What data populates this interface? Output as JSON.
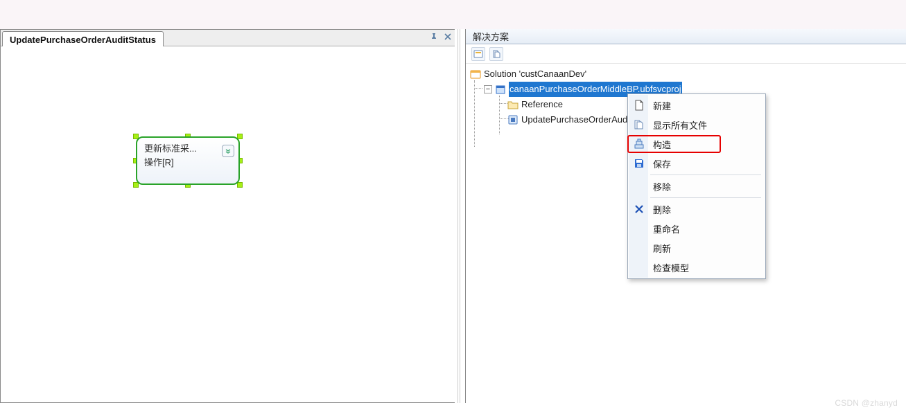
{
  "left": {
    "tab_title": "UpdatePurchaseOrderAuditStatus",
    "node_line1": "更新标准采...",
    "node_line2": "操作[R]"
  },
  "right": {
    "panel_title": "解决方案",
    "solution_label": "Solution 'custCanaanDev'",
    "project_label": "canaanPurchaseOrderMiddleBP.ubfsvcproj",
    "reference_label": "Reference",
    "item_label": "UpdatePurchaseOrderAuditStatus"
  },
  "menu": {
    "new": "新建",
    "show_all": "显示所有文件",
    "build": "构造",
    "save": "保存",
    "remove": "移除",
    "delete": "删除",
    "rename": "重命名",
    "refresh": "刷新",
    "check_model": "检查模型"
  },
  "watermark": "CSDN @zhanyd"
}
